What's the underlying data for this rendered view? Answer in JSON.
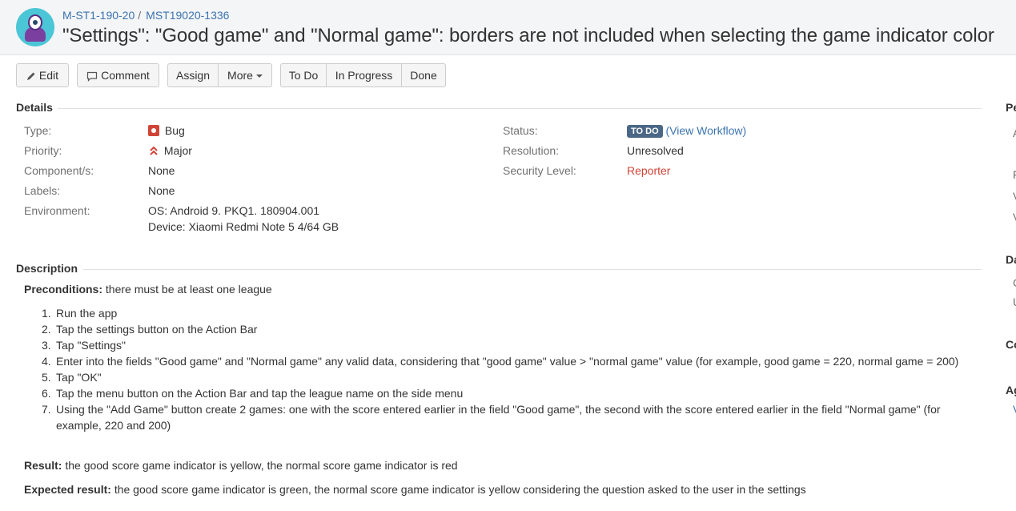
{
  "header": {
    "project_key": "M-ST1-190-20",
    "issue_key": "MST19020-1336",
    "title": "\"Settings\": \"Good game\" and \"Normal game\": borders are not included when selecting the game indicator color",
    "avatar_icon": "project-monster-icon"
  },
  "toolbar": {
    "edit": "Edit",
    "comment": "Comment",
    "assign": "Assign",
    "more": "More",
    "todo": "To Do",
    "in_progress": "In Progress",
    "done": "Done"
  },
  "details": {
    "heading": "Details",
    "type_label": "Type:",
    "type_value": "Bug",
    "priority_label": "Priority:",
    "priority_value": "Major",
    "components_label": "Component/s:",
    "components_value": "None",
    "labels_label": "Labels:",
    "labels_value": "None",
    "environment_label": "Environment:",
    "environment_line1": "OS: Android 9. PKQ1. 180904.001",
    "environment_line2": "Device: Xiaomi Redmi Note 5 4/64 GB",
    "status_label": "Status:",
    "status_value": "TO DO",
    "view_workflow_open": "(",
    "view_workflow": "View Workflow",
    "view_workflow_close": ")",
    "resolution_label": "Resolution:",
    "resolution_value": "Unresolved",
    "security_label": "Security Level:",
    "security_value": "Reporter"
  },
  "description": {
    "heading": "Description",
    "preconditions_label": "Preconditions:",
    "preconditions_text": " there must be at least one league",
    "steps": [
      {
        "num": "1.",
        "text": "Run the app"
      },
      {
        "num": "2.",
        "text": "Tap the settings button on the Action Bar"
      },
      {
        "num": "3.",
        "text": "Tap \"Settings\""
      },
      {
        "num": "4.",
        "text": "Enter into the fields \"Good game\" and \"Normal game\" any valid data, considering that \"good game\" value > \"normal game\" value (for example, good game = 220, normal game = 200)"
      },
      {
        "num": "5.",
        "text": "Tap \"OK\""
      },
      {
        "num": "6.",
        "text": "Tap the menu button on the Action Bar and tap the league name on the side menu"
      },
      {
        "num": "7.",
        "text": "Using the \"Add Game\" button create 2 games: one with the score entered earlier in the field \"Good game\", the second with the score entered earlier in the field \"Normal game\" (for example, 220 and 200)"
      }
    ],
    "result_label": "Result:",
    "result_text": " the good score game indicator is yellow, the normal score game indicator is red",
    "expected_label": "Expected result:",
    "expected_text": " the good score game indicator is green, the normal score game indicator is yellow considering the question asked to the user in the settings"
  },
  "side_panel": {
    "people_frag": "Pe",
    "dates_frag": "Da",
    "collab_frag": "Co",
    "agile_frag": "Ag",
    "f1": "A",
    "f2": "F",
    "f3": "V",
    "f4": "V",
    "f5": "C",
    "f6": "U",
    "f7": "V"
  },
  "colors": {
    "link": "#3b73af",
    "bug_red": "#d04437",
    "status_lozenge": "#4a6785",
    "avatar_bg": "#4bc6d6"
  }
}
